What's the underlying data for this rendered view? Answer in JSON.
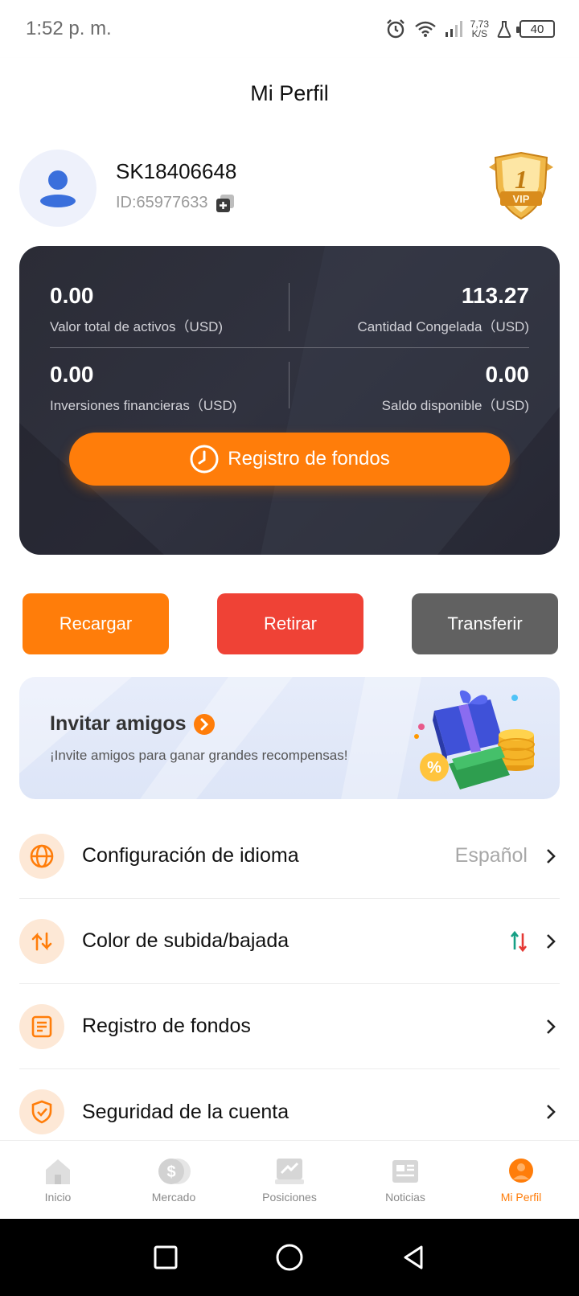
{
  "status_bar": {
    "time": "1:52 p. m.",
    "net_speed_value": "7,73",
    "net_speed_unit": "K/S",
    "battery": "40"
  },
  "header": {
    "title": "Mi Perfil"
  },
  "profile": {
    "username": "SK18406648",
    "id": "ID:65977633",
    "vip_level": "1",
    "vip_text": "VIP"
  },
  "assets": {
    "total_value": "0.00",
    "total_label": "Valor total de activos（USD)",
    "frozen_value": "113.27",
    "frozen_label": "Cantidad Congelada（USD)",
    "financial_value": "0.00",
    "financial_label": "Inversiones financieras（USD)",
    "available_value": "0.00",
    "available_label": "Saldo disponible（USD)",
    "funds_button": "Registro de fondos"
  },
  "actions": {
    "recharge": "Recargar",
    "withdraw": "Retirar",
    "transfer": "Transferir"
  },
  "invite": {
    "title": "Invitar amigos",
    "subtitle": "¡Invite amigos para ganar grandes recompensas!"
  },
  "menu": [
    {
      "label": "Configuración de idioma",
      "value": "Español",
      "icon": "globe-icon"
    },
    {
      "label": "Color de subida/bajada",
      "value": "",
      "icon": "swap-arrows-icon"
    },
    {
      "label": "Registro de fondos",
      "value": "",
      "icon": "document-icon"
    },
    {
      "label": "Seguridad de la cuenta",
      "value": "",
      "icon": "shield-check-icon"
    }
  ],
  "tabbar": {
    "home": "Inicio",
    "market": "Mercado",
    "positions": "Posiciones",
    "news": "Noticias",
    "profile": "Mi Perfil",
    "active": "profile"
  },
  "colors": {
    "accent": "#ff7d0a",
    "withdraw": "#ef4236",
    "transfer": "#616161",
    "up": "#16a085",
    "down": "#e53935"
  }
}
